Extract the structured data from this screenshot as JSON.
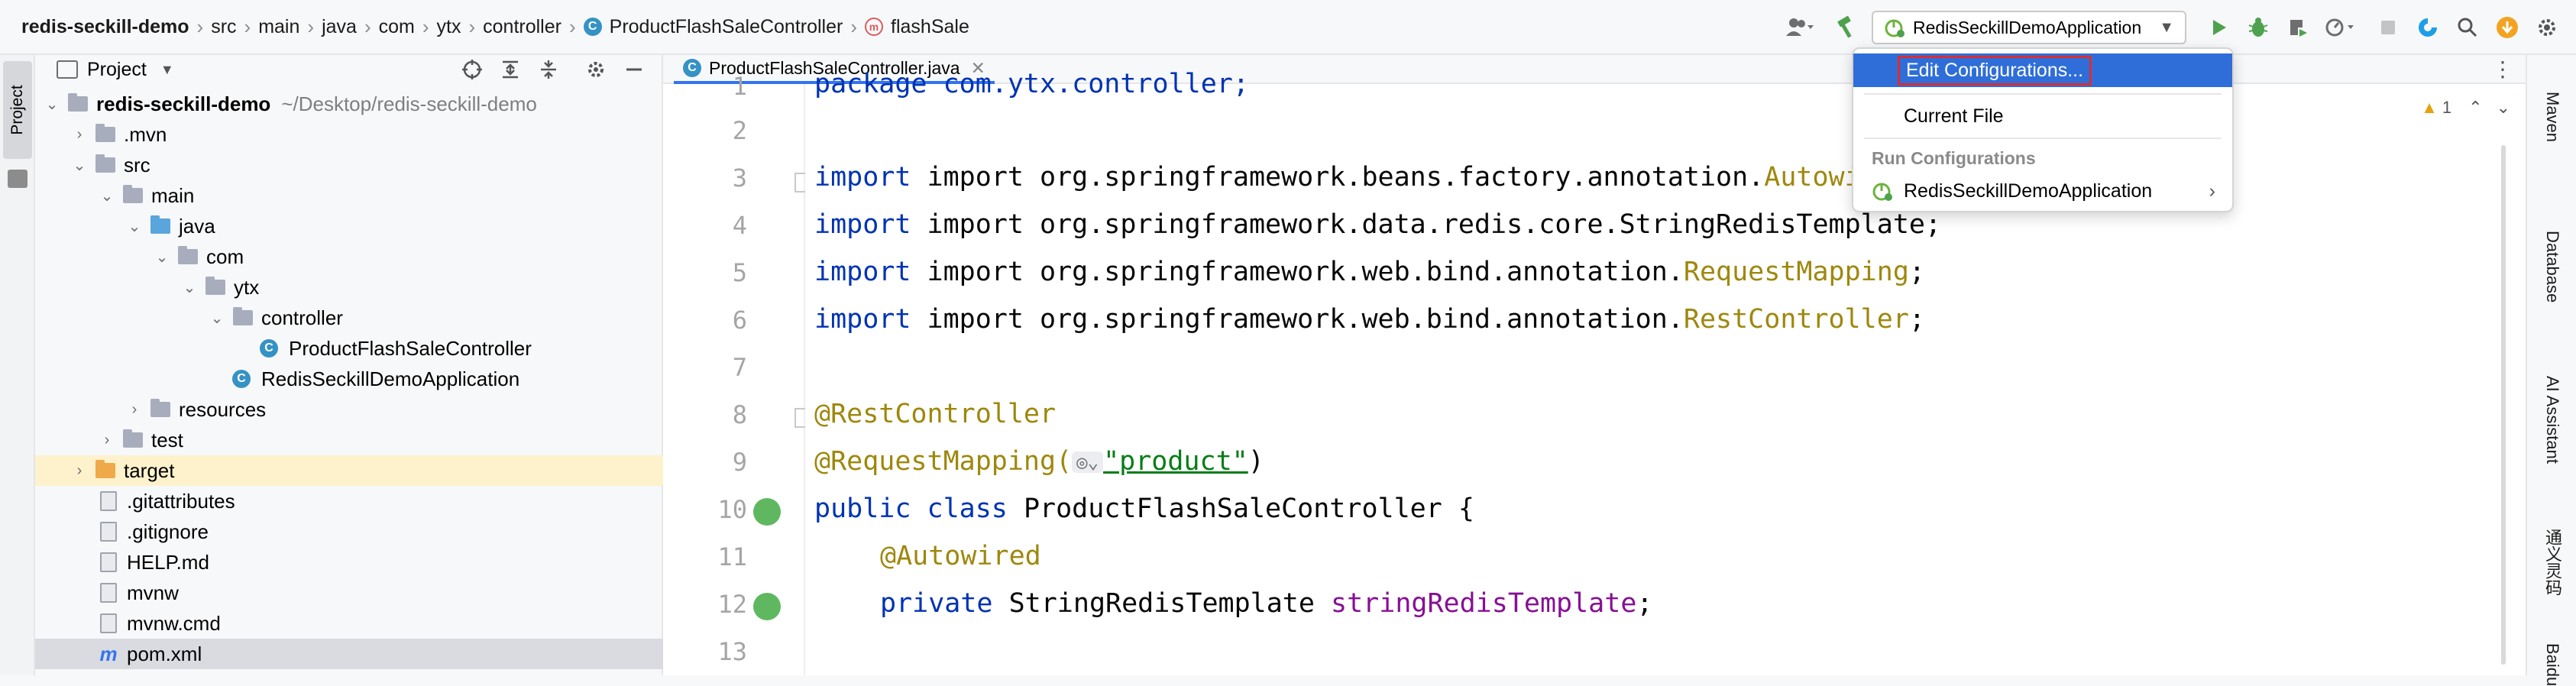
{
  "breadcrumbs": [
    "redis-seckill-demo",
    "src",
    "main",
    "java",
    "com",
    "ytx",
    "controller",
    "ProductFlashSaleController",
    "flashSale"
  ],
  "run_config": {
    "selected": "RedisSeckillDemoApplication"
  },
  "left_stripe": {
    "project_label": "Project"
  },
  "project_panel": {
    "title": "Project",
    "tree": [
      {
        "label": "redis-seckill-demo",
        "path": "~/Desktop/redis-seckill-demo"
      },
      {
        "label": ".mvn"
      },
      {
        "label": "src"
      },
      {
        "label": "main"
      },
      {
        "label": "java"
      },
      {
        "label": "com"
      },
      {
        "label": "ytx"
      },
      {
        "label": "controller"
      },
      {
        "label": "ProductFlashSaleController"
      },
      {
        "label": "RedisSeckillDemoApplication"
      },
      {
        "label": "resources"
      },
      {
        "label": "test"
      },
      {
        "label": "target"
      },
      {
        "label": ".gitattributes"
      },
      {
        "label": ".gitignore"
      },
      {
        "label": "HELP.md"
      },
      {
        "label": "mvnw"
      },
      {
        "label": "mvnw.cmd"
      },
      {
        "label": "pom.xml"
      }
    ]
  },
  "editor": {
    "tab": "ProductFlashSaleController.java",
    "warnings": "1",
    "line_numbers": [
      "1",
      "2",
      "3",
      "4",
      "5",
      "6",
      "7",
      "8",
      "9",
      "10",
      "11",
      "12",
      "13"
    ],
    "code": {
      "l1": "package com.ytx.controller;",
      "l3_pre": "import org.springframework.beans.factory.annotation.",
      "l3_ann": "Autowired",
      "l4": "import org.springframework.data.redis.core.StringRedisTemplate;",
      "l5_pre": "import org.springframework.web.bind.annotation.",
      "l5_ann": "RequestMapping",
      "l6_pre": "import org.springframework.web.bind.annotation.",
      "l6_ann": "RestController",
      "l8": "@RestController",
      "l9_ann": "@RequestMapping(",
      "l9_str": "\"product\"",
      "l9_end": ")",
      "l10_kw": "public class",
      "l10_rest": " ProductFlashSaleController {",
      "l11": "@Autowired",
      "l12_kw": "private",
      "l12_type": " StringRedisTemplate ",
      "l12_field": "stringRedisTemplate",
      "l12_end": ";"
    }
  },
  "popup": {
    "edit_configurations": "Edit Configurations...",
    "current_file": "Current File",
    "run_configurations_heading": "Run Configurations",
    "run_config_item": "RedisSeckillDemoApplication"
  },
  "right_stripe": [
    "Maven",
    "Database",
    "AI Assistant",
    "通义灵码",
    "Baidu"
  ]
}
